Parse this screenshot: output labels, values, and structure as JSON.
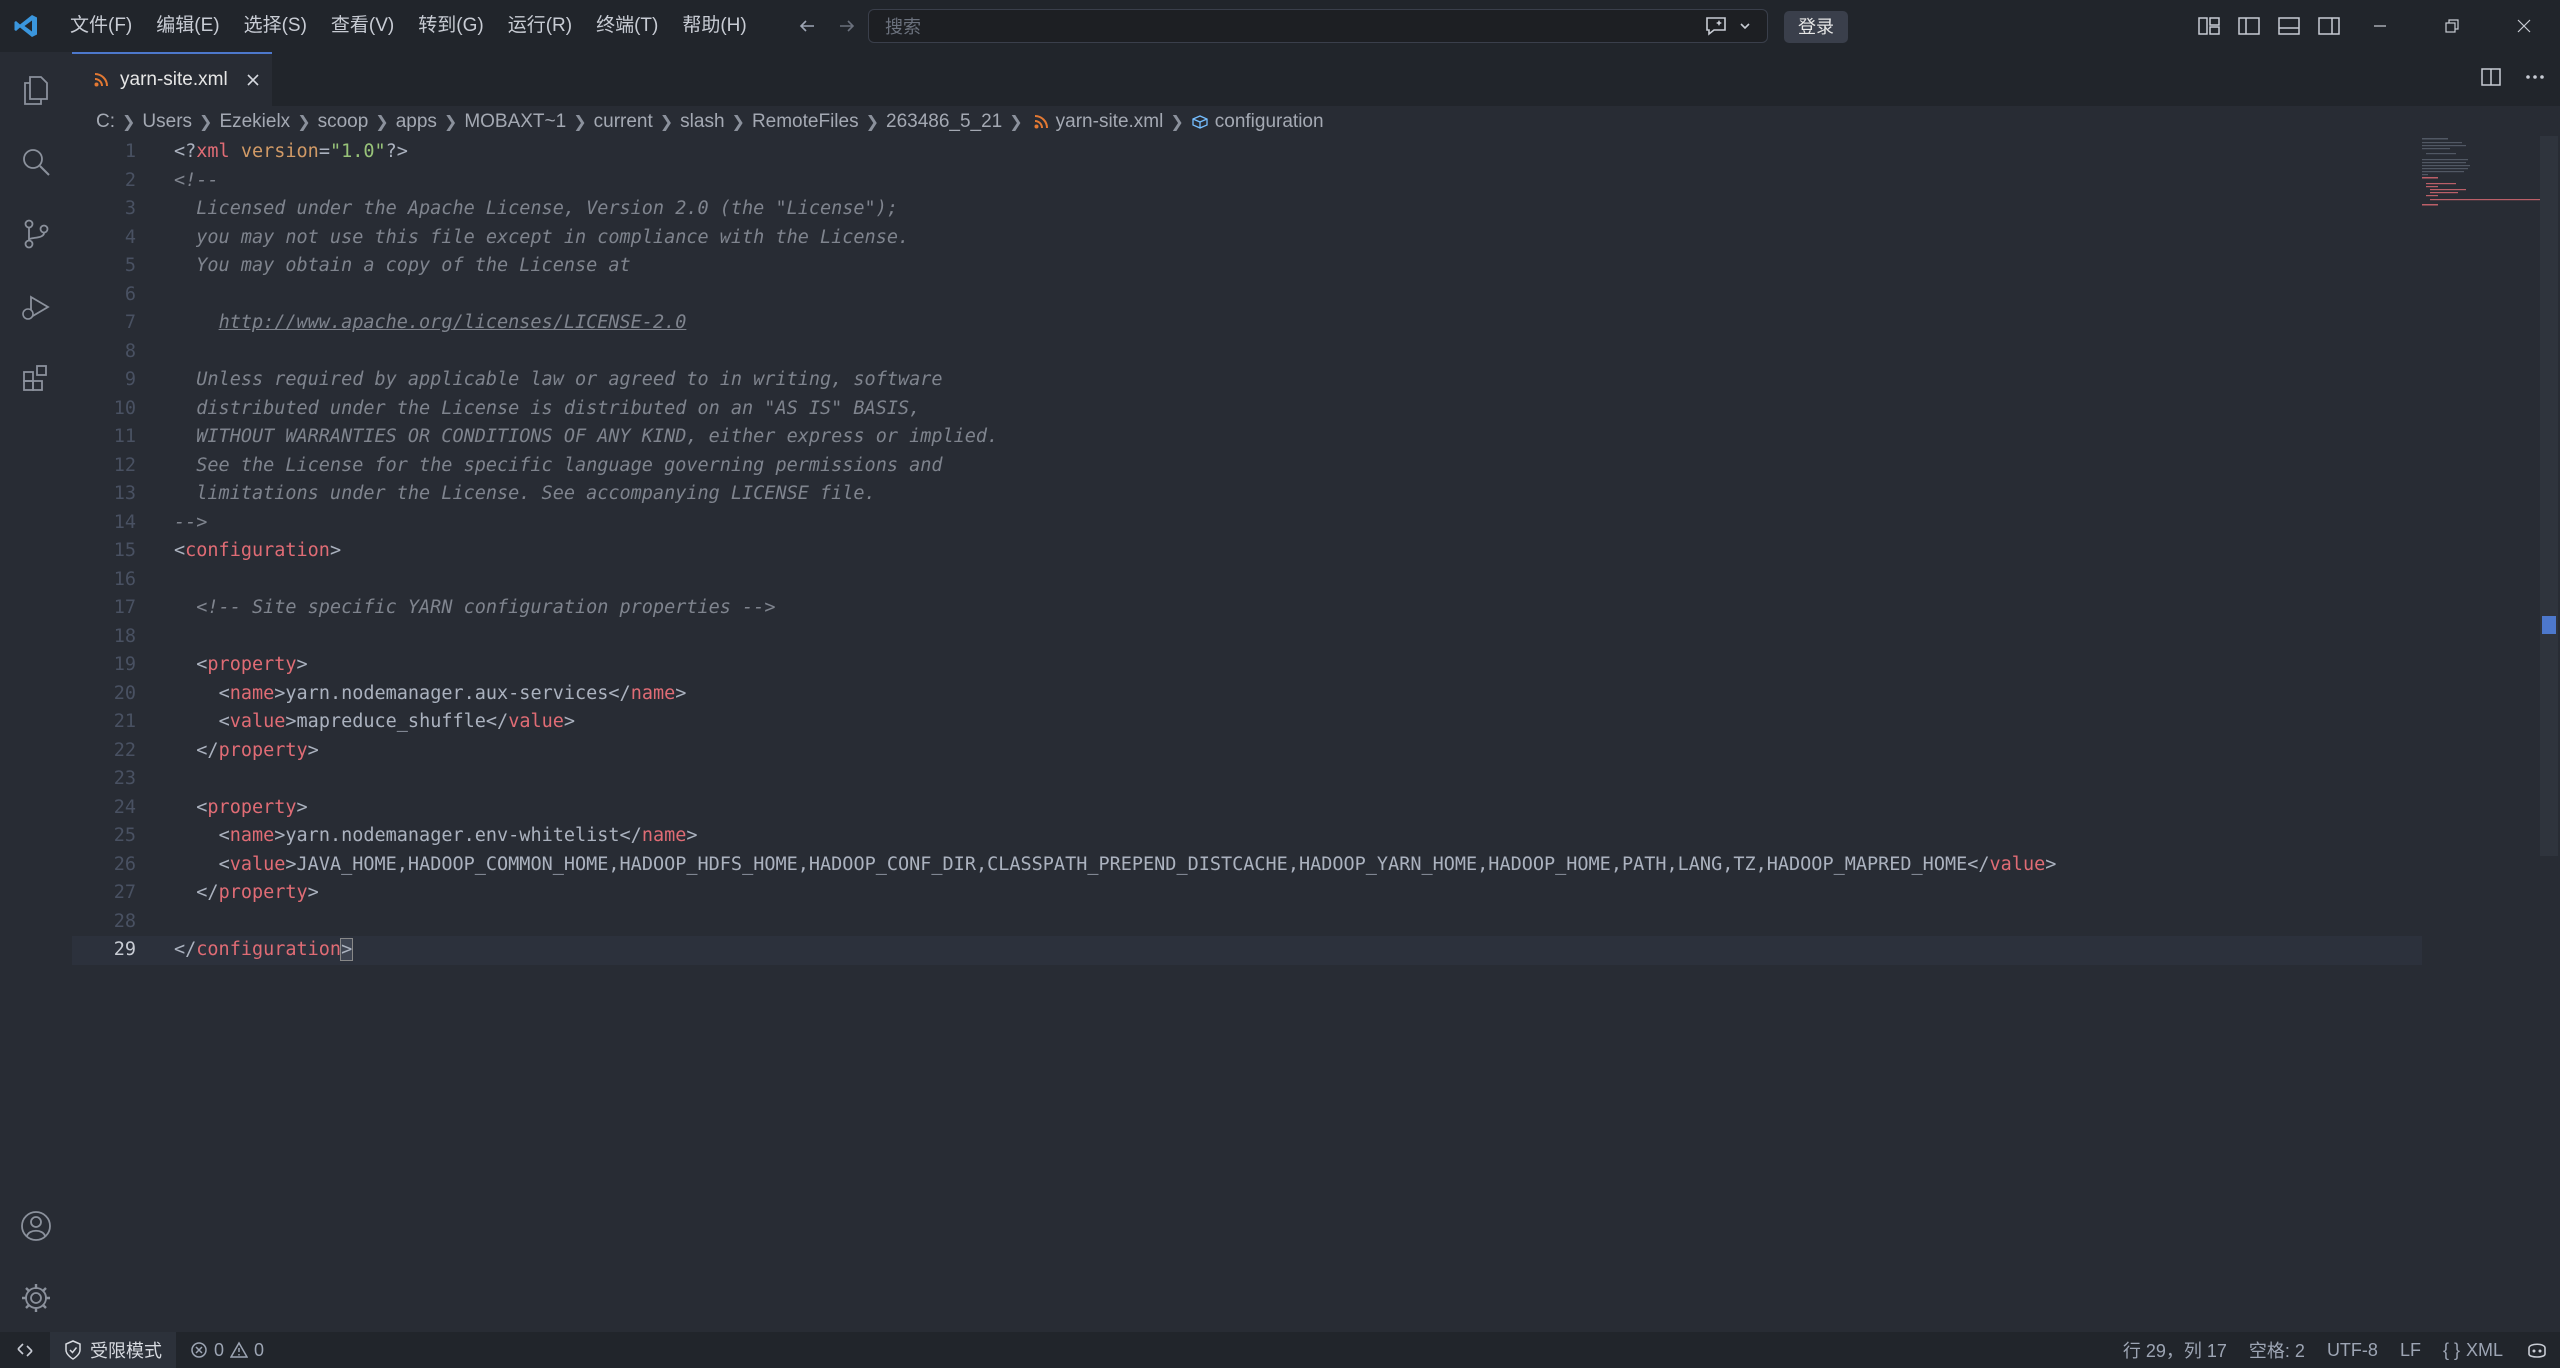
{
  "titlebar": {
    "menu": [
      "文件(F)",
      "编辑(E)",
      "选择(S)",
      "查看(V)",
      "转到(G)",
      "运行(R)",
      "终端(T)",
      "帮助(H)"
    ],
    "search_placeholder": "搜索",
    "login_label": "登录"
  },
  "tab": {
    "label": "yarn-site.xml"
  },
  "breadcrumb": [
    "C:",
    "Users",
    "Ezekielx",
    "scoop",
    "apps",
    "MOBAXT~1",
    "current",
    "slash",
    "RemoteFiles",
    "263486_5_21",
    "yarn-site.xml",
    "configuration"
  ],
  "editor": {
    "line_numbers": [
      "1",
      "2",
      "3",
      "4",
      "5",
      "6",
      "7",
      "8",
      "9",
      "10",
      "11",
      "12",
      "13",
      "14",
      "15",
      "16",
      "17",
      "18",
      "19",
      "20",
      "21",
      "22",
      "23",
      "24",
      "25",
      "26",
      "27",
      "28",
      "29"
    ],
    "current_line": 29,
    "lines": [
      [
        "<?",
        "xml",
        " ",
        "version",
        "=",
        "\"1.0\"",
        "?>"
      ],
      [
        "<!--"
      ],
      [
        "  Licensed under the Apache License, Version 2.0 (the \"License\");"
      ],
      [
        "  you may not use this file except in compliance with the License."
      ],
      [
        "  You may obtain a copy of the License at"
      ],
      [
        ""
      ],
      [
        "    ",
        "http://www.apache.org/licenses/LICENSE-2.0"
      ],
      [
        ""
      ],
      [
        "  Unless required by applicable law or agreed to in writing, software"
      ],
      [
        "  distributed under the License is distributed on an \"AS IS\" BASIS,"
      ],
      [
        "  WITHOUT WARRANTIES OR CONDITIONS OF ANY KIND, either express or implied."
      ],
      [
        "  See the License for the specific language governing permissions and"
      ],
      [
        "  limitations under the License. See accompanying LICENSE file."
      ],
      [
        "-->"
      ],
      [
        "<",
        "configuration",
        ">"
      ],
      [
        ""
      ],
      [
        "  ",
        "<!-- Site specific YARN configuration properties -->"
      ],
      [
        ""
      ],
      [
        "  ",
        "<",
        "property",
        ">"
      ],
      [
        "    ",
        "<",
        "name",
        ">",
        "yarn.nodemanager.aux-services",
        "</",
        "name",
        ">"
      ],
      [
        "    ",
        "<",
        "value",
        ">",
        "mapreduce_shuffle",
        "</",
        "value",
        ">"
      ],
      [
        "  ",
        "</",
        "property",
        ">"
      ],
      [
        ""
      ],
      [
        "  ",
        "<",
        "property",
        ">"
      ],
      [
        "    ",
        "<",
        "name",
        ">",
        "yarn.nodemanager.env-whitelist",
        "</",
        "name",
        ">"
      ],
      [
        "    ",
        "<",
        "value",
        ">",
        "JAVA_HOME,HADOOP_COMMON_HOME,HADOOP_HDFS_HOME,HADOOP_CONF_DIR,CLASSPATH_PREPEND_DISTCACHE,HADOOP_YARN_HOME,HADOOP_HOME,PATH,LANG,TZ,HADOOP_MAPRED_HOME",
        "</",
        "value",
        ">"
      ],
      [
        "  ",
        "</",
        "property",
        ">"
      ],
      [
        ""
      ],
      [
        "</",
        "configuration",
        ">"
      ]
    ],
    "token_classes": [
      [
        "c-punc",
        "c-tag",
        "c-punc",
        "c-attr",
        "c-punc",
        "c-str",
        "c-punc"
      ],
      [
        "c-com"
      ],
      [
        "c-com"
      ],
      [
        "c-com"
      ],
      [
        "c-com"
      ],
      [
        "c-com"
      ],
      [
        "c-com",
        "c-link"
      ],
      [
        "c-com"
      ],
      [
        "c-com"
      ],
      [
        "c-com"
      ],
      [
        "c-com"
      ],
      [
        "c-com"
      ],
      [
        "c-com"
      ],
      [
        "c-com"
      ],
      [
        "c-punc",
        "c-tag",
        "c-punc"
      ],
      [
        "c-text"
      ],
      [
        "c-text",
        "c-com"
      ],
      [
        "c-text"
      ],
      [
        "c-text",
        "c-punc",
        "c-tag",
        "c-punc"
      ],
      [
        "c-text",
        "c-punc",
        "c-tag",
        "c-punc",
        "c-text",
        "c-punc",
        "c-tag",
        "c-punc"
      ],
      [
        "c-text",
        "c-punc",
        "c-tag",
        "c-punc",
        "c-text",
        "c-punc",
        "c-tag",
        "c-punc"
      ],
      [
        "c-text",
        "c-punc",
        "c-tag",
        "c-punc"
      ],
      [
        "c-text"
      ],
      [
        "c-text",
        "c-punc",
        "c-tag",
        "c-punc"
      ],
      [
        "c-text",
        "c-punc",
        "c-tag",
        "c-punc",
        "c-text",
        "c-punc",
        "c-tag",
        "c-punc"
      ],
      [
        "c-text",
        "c-punc",
        "c-tag",
        "c-punc",
        "c-text",
        "c-punc",
        "c-tag",
        "c-punc"
      ],
      [
        "c-text",
        "c-punc",
        "c-tag",
        "c-punc"
      ],
      [
        "c-text"
      ],
      [
        "c-punc",
        "c-tag",
        "c-punc"
      ]
    ]
  },
  "statusbar": {
    "restricted_mode": "受限模式",
    "errors": "0",
    "warnings": "0",
    "cursor_position": "行 29，列 17",
    "indent": "空格: 2",
    "encoding": "UTF-8",
    "eol": "LF",
    "language": "XML"
  },
  "colors": {
    "accent": "#4d78cc",
    "tag": "#e06c75",
    "string": "#98c379",
    "attribute": "#d19a66",
    "comment": "#7f848e"
  }
}
